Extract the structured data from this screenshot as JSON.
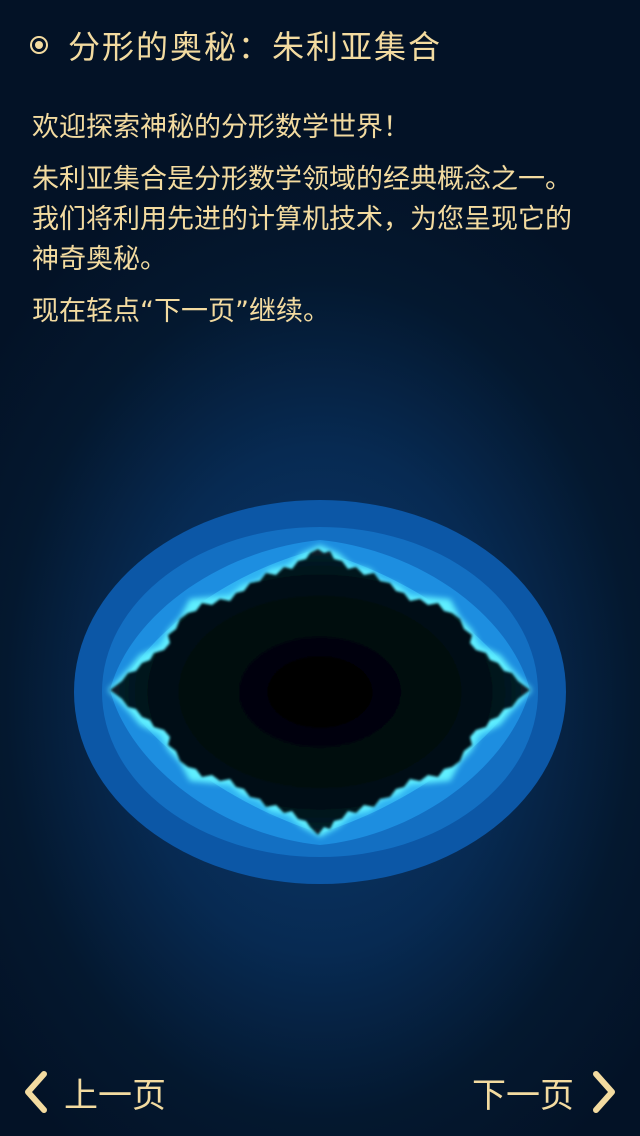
{
  "header": {
    "icon": "radio-button-icon",
    "title": "分形的奥秘：朱利亚集合"
  },
  "content": {
    "paragraphs": [
      "欢迎探索神秘的分形数学世界！",
      "朱利亚集合是分形数学领域的经典概念之一。我们将利用先进的计算机技术，为您呈现它的神奇奥秘。",
      "现在轻点“下一页”继续。"
    ]
  },
  "colors": {
    "text": "#f3dba0",
    "background": "#04182f",
    "fractal_outer": "#0d5aa8",
    "fractal_glow": "#3fe0ff",
    "fractal_core": "#000000"
  },
  "nav": {
    "prev_label": "上一页",
    "prev_icon": "chevron-left-icon",
    "next_label": "下一页",
    "next_icon": "chevron-right-icon"
  }
}
